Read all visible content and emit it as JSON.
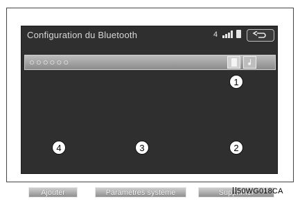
{
  "screen": {
    "title": "Configuration du Bluetooth",
    "status": {
      "signal_label": "4"
    },
    "device": {
      "name": "○○○○○○"
    }
  },
  "callouts": {
    "c1": "1",
    "c2": "2",
    "c3": "3",
    "c4": "4"
  },
  "buttons": {
    "add_label": "Ajouter",
    "system_label": "Paramètres système",
    "delete_label": "Supprimer"
  },
  "figure": {
    "code": "50WG018CA"
  }
}
